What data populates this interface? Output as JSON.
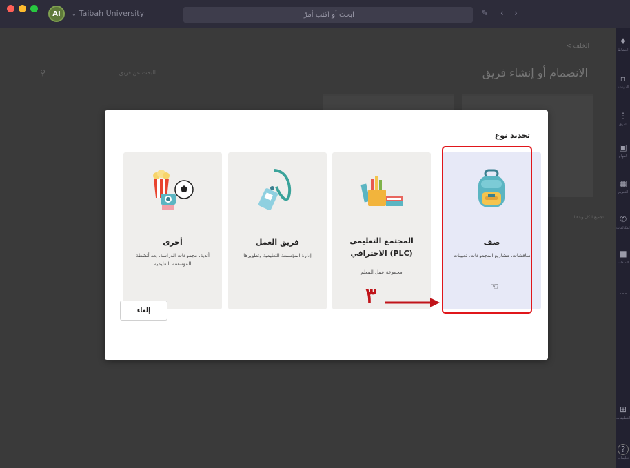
{
  "titlebar": {
    "org_initials": "AI",
    "org_name": "Taibah University",
    "search_placeholder": "ابحث أو اكتب أمرًا"
  },
  "background": {
    "breadcrumb": "< الخلف",
    "title": "الانضمام أو إنشاء فريق",
    "search_placeholder": "البحث عن فريق",
    "card_text": "تجميع الكل وبدء الـ"
  },
  "modal": {
    "title": "تحديد نوع",
    "cards": [
      {
        "name": "صف",
        "desc": "مناقشات، مشاريع المجموعات، تعيينات"
      },
      {
        "name": "المجتمع التعليمي الاحترافي (PLC)",
        "desc": "مجموعة عمل المعلم"
      },
      {
        "name": "فريق العمل",
        "desc": "إدارة المؤسسة التعليمية وتطويرها"
      },
      {
        "name": "أخرى",
        "desc": "أندية، مجموعات الدراسة، بعد أنشطة المؤسسة التعليمية"
      }
    ],
    "cancel_label": "إلغاء"
  },
  "annotation": {
    "step_number": "٣"
  },
  "rail": {
    "labels": [
      "النشاط",
      "الدردشة",
      "الفرق",
      "المهام",
      "التقويم",
      "المكالمات",
      "الملفات",
      "التطبيقات",
      "تعليمات"
    ]
  },
  "colors": {
    "highlight": "#e0161b",
    "titlebar": "#2d2c3a",
    "class_card_bg": "#e7e9f7"
  }
}
